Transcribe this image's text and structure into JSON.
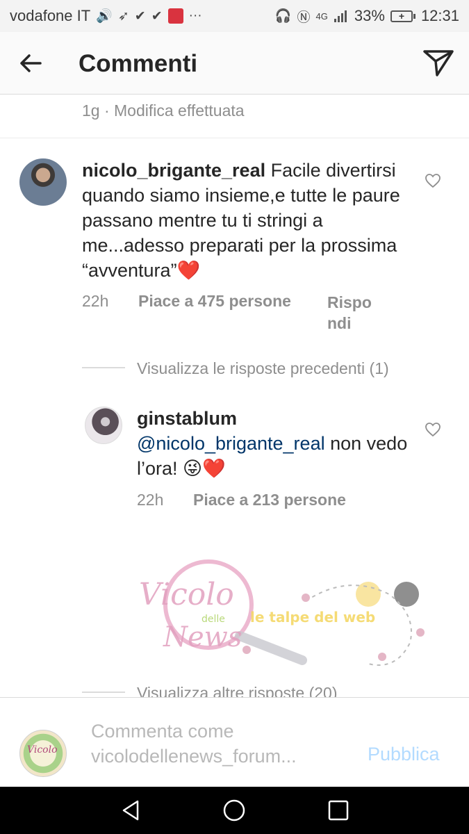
{
  "status_bar": {
    "carrier": "vodafone IT",
    "battery_percent": "33%",
    "time": "12:31",
    "network": "4G"
  },
  "header": {
    "title": "Commenti",
    "back_icon": "arrow-left-icon",
    "send_icon": "paper-plane-icon"
  },
  "caption_meta": {
    "text": "1g · Modifica effettuata"
  },
  "comments": [
    {
      "username": "nicolo_brigante_real",
      "text": "Facile divertirsi quando siamo insieme,e tutte le paure passano mentre tu ti stringi a me...adesso preparati per la prossima “avventura”❤️",
      "time": "22h",
      "likes": "Piace a 475 persone",
      "reply": "Rispondi",
      "view_previous_replies": "Visualizza le risposte precedenti (1)"
    }
  ],
  "replies": [
    {
      "username": "ginstablum",
      "mention": "@nicolo_brigante_real",
      "text": "non vedo l’ora! 😜❤️",
      "time": "22h",
      "likes": "Piace a 213 persone"
    }
  ],
  "more_replies": "Visualizza altre risposte (20)",
  "comment_bar": {
    "placeholder": "Commenta come vicolodellenews_forum...",
    "publish": "Pubblica"
  },
  "watermark": {
    "text1": "Vicolo",
    "text2": "delle",
    "text3": "News",
    "tagline": "le talpe del web"
  },
  "colors": {
    "mention": "#003569",
    "publish": "#b3dbff",
    "heart_red": "#e0245e"
  }
}
